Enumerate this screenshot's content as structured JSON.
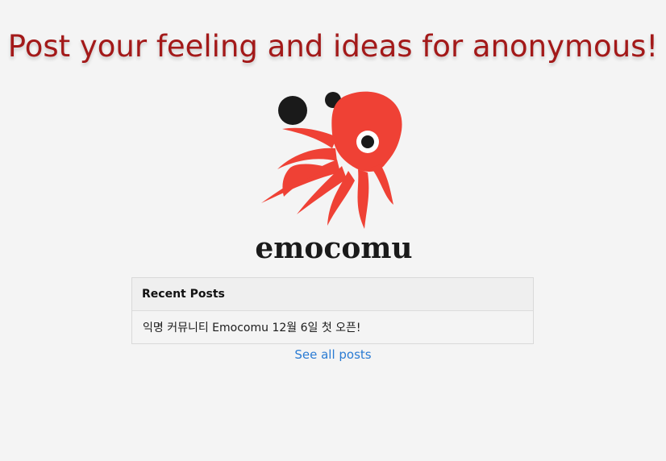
{
  "hero": {
    "title": "Post your feeling and ideas for anonymous!"
  },
  "logo": {
    "wordmark": "emocomu",
    "icon": "octopus-icon",
    "colors": {
      "octopus": "#ef4135",
      "bubbles": "#1a1a1a",
      "wordmark": "#1a1a1a"
    }
  },
  "recent_posts": {
    "heading": "Recent Posts",
    "items": [
      {
        "title": "익명 커뮤니티 Emocomu 12월 6일 첫 오픈!"
      }
    ],
    "see_all_label": "See all posts"
  },
  "colors": {
    "title": "#a31919",
    "link": "#2a7bd3",
    "background": "#f4f4f4"
  }
}
